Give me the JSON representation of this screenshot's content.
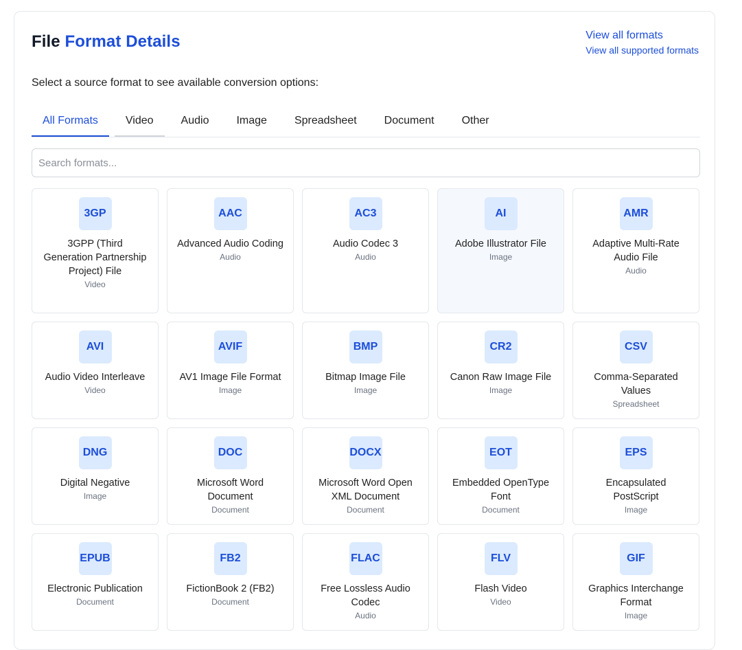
{
  "header": {
    "title_part1": "File",
    "title_part2": "Format Details"
  },
  "links": {
    "view_all": "View all formats",
    "view_all_supported": "View all supported formats"
  },
  "subtitle": "Select a source format to see available conversion options:",
  "tabs": [
    {
      "label": "All Formats"
    },
    {
      "label": "Video"
    },
    {
      "label": "Audio"
    },
    {
      "label": "Image"
    },
    {
      "label": "Spreadsheet"
    },
    {
      "label": "Document"
    },
    {
      "label": "Other"
    }
  ],
  "active_tab": "All Formats",
  "search": {
    "placeholder": "Search formats...",
    "value": ""
  },
  "formats": [
    {
      "code": "3GP",
      "name": "3GPP (Third Generation Partnership Project) File",
      "category": "Video"
    },
    {
      "code": "AAC",
      "name": "Advanced Audio Coding",
      "category": "Audio"
    },
    {
      "code": "AC3",
      "name": "Audio Codec 3",
      "category": "Audio"
    },
    {
      "code": "AI",
      "name": "Adobe Illustrator File",
      "category": "Image"
    },
    {
      "code": "AMR",
      "name": "Adaptive Multi-Rate Audio File",
      "category": "Audio"
    },
    {
      "code": "AVI",
      "name": "Audio Video Interleave",
      "category": "Video"
    },
    {
      "code": "AVIF",
      "name": "AV1 Image File Format",
      "category": "Image"
    },
    {
      "code": "BMP",
      "name": "Bitmap Image File",
      "category": "Image"
    },
    {
      "code": "CR2",
      "name": "Canon Raw Image File",
      "category": "Image"
    },
    {
      "code": "CSV",
      "name": "Comma-Separated Values",
      "category": "Spreadsheet"
    },
    {
      "code": "DNG",
      "name": "Digital Negative",
      "category": "Image"
    },
    {
      "code": "DOC",
      "name": "Microsoft Word Document",
      "category": "Document"
    },
    {
      "code": "DOCX",
      "name": "Microsoft Word Open XML Document",
      "category": "Document"
    },
    {
      "code": "EOT",
      "name": "Embedded OpenType Font",
      "category": "Document"
    },
    {
      "code": "EPS",
      "name": "Encapsulated PostScript",
      "category": "Image"
    },
    {
      "code": "EPUB",
      "name": "Electronic Publication",
      "category": "Document"
    },
    {
      "code": "FB2",
      "name": "FictionBook 2 (FB2)",
      "category": "Document"
    },
    {
      "code": "FLAC",
      "name": "Free Lossless Audio Codec",
      "category": "Audio"
    },
    {
      "code": "FLV",
      "name": "Flash Video",
      "category": "Video"
    },
    {
      "code": "GIF",
      "name": "Graphics Interchange Format",
      "category": "Image"
    }
  ],
  "colors": {
    "accent": "#1d4ed8",
    "badge_bg": "#dbeafe",
    "border": "#e5e7eb"
  }
}
